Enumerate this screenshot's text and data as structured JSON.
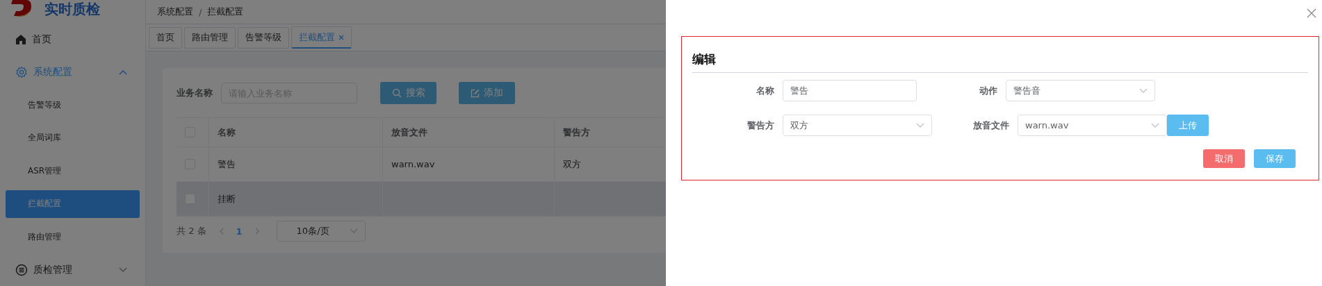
{
  "sidebar": {
    "logo_text": "实时质检",
    "items": [
      {
        "label": "首页",
        "kind": "home",
        "highlighted": false
      },
      {
        "label": "系统配置",
        "kind": "gear",
        "highlighted": true,
        "expanded": true,
        "children": [
          {
            "label": "告警等级",
            "selected": false
          },
          {
            "label": "全局词库",
            "selected": false
          },
          {
            "label": "ASR管理",
            "selected": false
          },
          {
            "label": "拦截配置",
            "selected": true
          },
          {
            "label": "路由管理",
            "selected": false
          }
        ]
      },
      {
        "label": "质检管理",
        "kind": "list",
        "highlighted": false,
        "expanded": false
      }
    ]
  },
  "breadcrumb": {
    "items": [
      "系统配置",
      "拦截配置"
    ],
    "separator": "/"
  },
  "tabs": [
    {
      "label": "首页",
      "selected": false,
      "closable": false
    },
    {
      "label": "路由管理",
      "selected": false,
      "closable": false
    },
    {
      "label": "告警等级",
      "selected": false,
      "closable": false
    },
    {
      "label": "拦截配置",
      "selected": true,
      "closable": true
    }
  ],
  "search": {
    "label": "业务名称",
    "placeholder": "请输入业务名称",
    "buttons": [
      {
        "label": "搜索",
        "kind": "search"
      },
      {
        "label": "添加",
        "kind": "edit"
      }
    ]
  },
  "table": {
    "header_checked": false,
    "columns": [
      "名称",
      "放音文件",
      "警告方"
    ],
    "rows": [
      {
        "checked": false,
        "hovered": false,
        "cells": [
          "警告",
          "warn.wav",
          "双方"
        ]
      },
      {
        "checked": false,
        "hovered": true,
        "cells": [
          "挂断"
        ]
      }
    ]
  },
  "pagination": {
    "total": "共 2 条",
    "pages": [
      {
        "label": "1",
        "selected": true
      }
    ],
    "page_size": "10条/页"
  },
  "drawer": {
    "title": "编辑",
    "rows": [
      [
        {
          "label": "名称",
          "kind": "input",
          "value": "警告"
        },
        {
          "label": "动作",
          "kind": "select",
          "value": "警告音"
        }
      ],
      [
        {
          "label": "警告方",
          "kind": "select",
          "value": "双方"
        },
        {
          "label": "放音文件",
          "kind": "select",
          "value": "warn.wav",
          "button": "上传"
        }
      ]
    ],
    "buttons": [
      {
        "label": "取消",
        "kind": "danger"
      },
      {
        "label": "保存",
        "kind": "primary"
      }
    ]
  }
}
